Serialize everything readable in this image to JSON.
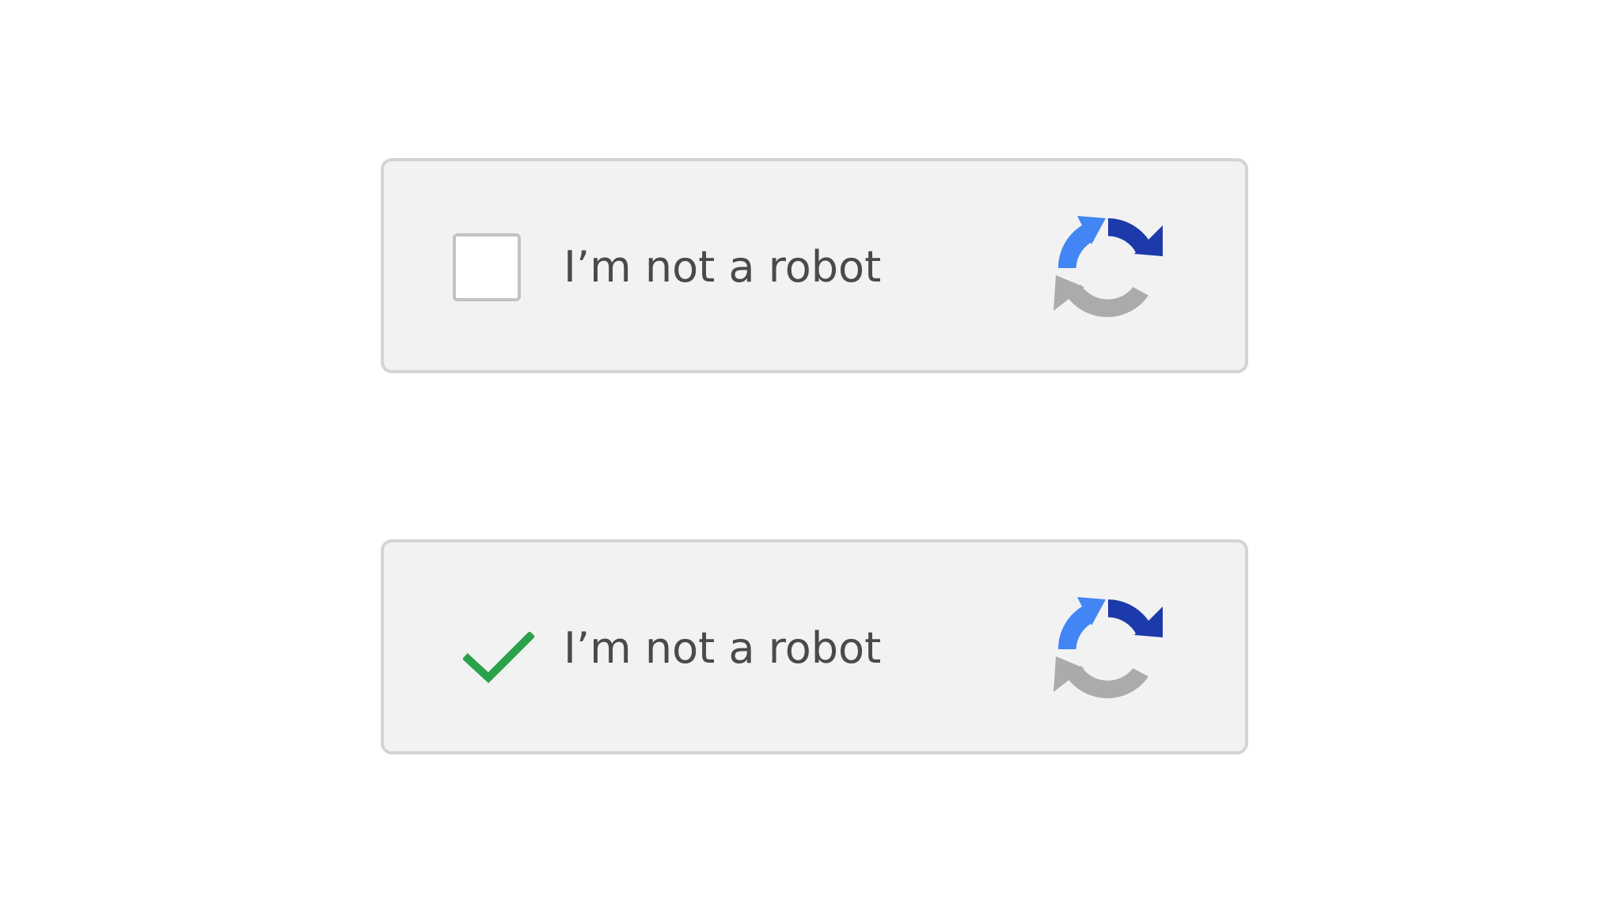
{
  "recaptcha_widgets": [
    {
      "state": "unchecked",
      "label": "I’m not a robot",
      "logo_icon": "recaptcha-logo-icon"
    },
    {
      "state": "checked",
      "label": "I’m not a robot",
      "checkmark_icon": "checkmark-icon",
      "logo_icon": "recaptcha-logo-icon"
    }
  ],
  "colors": {
    "background": "#ffffff",
    "widget_background": "#f2f2f2",
    "widget_border": "#d4d4d4",
    "label_text": "#4a4a4a",
    "checkbox_border": "#c2c2c2",
    "checkmark_green": "#2aa14b",
    "logo_light_blue": "#4285f4",
    "logo_dark_blue": "#1c3aa9",
    "logo_gray": "#ababab"
  }
}
